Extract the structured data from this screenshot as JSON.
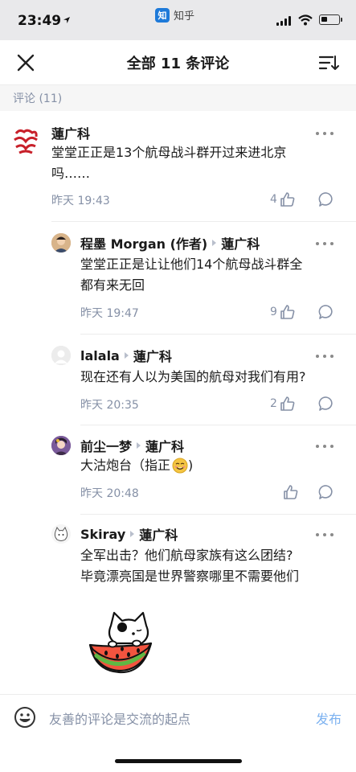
{
  "status_bar": {
    "time": "23:49",
    "app_name": "知乎",
    "app_badge": "知"
  },
  "header": {
    "title": "全部 11 条评论",
    "close_icon": "close-icon",
    "sort_icon": "sort-icon"
  },
  "section": {
    "label": "评论 (11)"
  },
  "comments": [
    {
      "author": "蓮广科",
      "reply_to": "",
      "text_lines": [
        "堂堂正正是13个航母战斗群开过来进北京",
        "吗……"
      ],
      "time": "昨天 19:43",
      "likes": "4"
    },
    {
      "author": "程墨 Morgan (作者)",
      "reply_to": "蓮广科",
      "text_lines": [
        "堂堂正正是让让他们14个航母战斗群全",
        "都有来无回"
      ],
      "time": "昨天 19:47",
      "likes": "9"
    },
    {
      "author": "lalala",
      "reply_to": "蓮广科",
      "text_lines": [
        "现在还有人以为美国的航母对我们有用?"
      ],
      "time": "昨天 20:35",
      "likes": "2"
    },
    {
      "author": "前尘一梦",
      "reply_to": "蓮广科",
      "text_lines": [
        "大沽炮台（指正"
      ],
      "time": "昨天 20:48",
      "likes": ""
    },
    {
      "author": "Skiray",
      "reply_to": "蓮广科",
      "text_lines": [
        "全军出击？他们航母家族有这么团结?",
        "毕竟漂亮国是世界警察哪里不需要他们"
      ],
      "time": "",
      "likes": ""
    }
  ],
  "bottom_bar": {
    "placeholder": "友善的评论是交流的起点",
    "send_label": "发布"
  },
  "colors": {
    "accent": "#7bb1f0",
    "meta": "#8590a6",
    "logo_red": "#c8202a"
  }
}
